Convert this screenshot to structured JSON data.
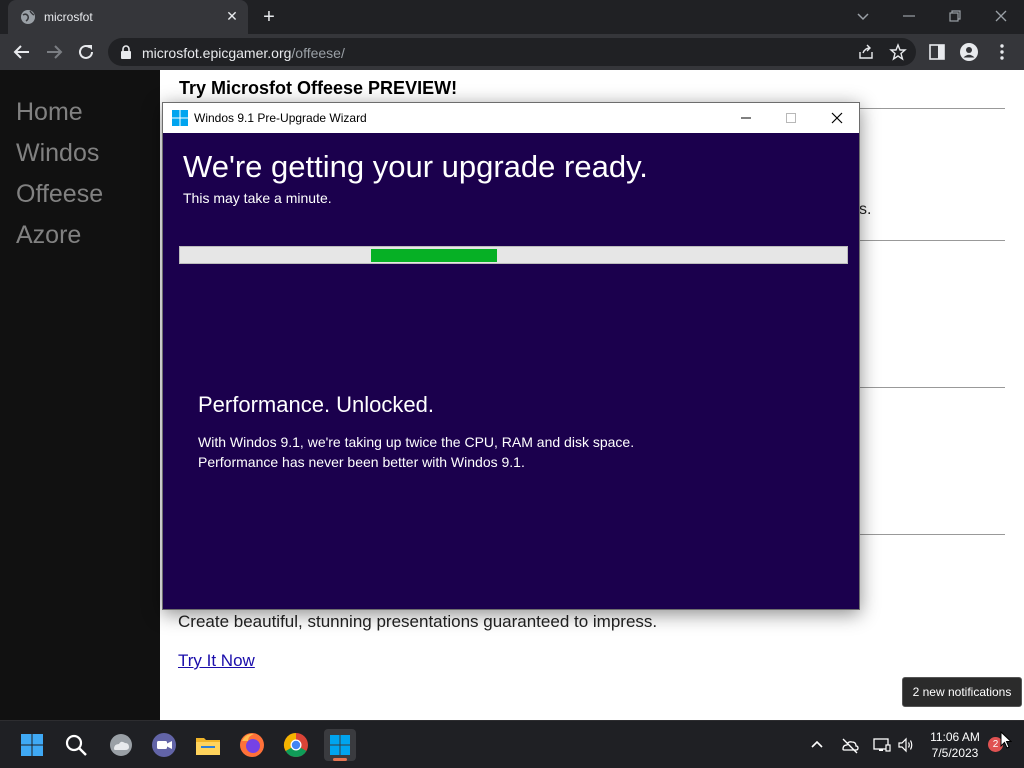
{
  "browser": {
    "tab_title": "microsfot",
    "tab_close": "✕",
    "new_tab": "+",
    "url_host": "microsfot.epicgamer.org",
    "url_path": "/offeese/"
  },
  "sidebar": {
    "items": [
      {
        "label": "Home"
      },
      {
        "label": "Windos"
      },
      {
        "label": "Offeese"
      },
      {
        "label": "Azore"
      }
    ]
  },
  "page": {
    "heading": "Try Microsfot Offeese PREVIEW!",
    "stray_text": "s.",
    "description": "Create beautiful, stunning presentations guaranteed to impress.",
    "link": "Try It Now"
  },
  "wizard": {
    "title": "Windos 9.1 Pre-Upgrade Wizard",
    "heading": "We're getting your upgrade ready.",
    "subheading": "This may take a minute.",
    "progress_start": 0.286,
    "progress_end": 0.476,
    "feature_title": "Performance. Unlocked.",
    "feature_lines": [
      "With Windos 9.1, we're taking up twice the CPU, RAM and disk space.",
      "Performance has never been better with Windos 9.1."
    ]
  },
  "taskbar": {
    "time": "11:06 AM",
    "date": "7/5/2023",
    "notification_count": "2",
    "toast": "2 new notifications"
  },
  "colors": {
    "wizard_bg": "#1b004d",
    "progress_fill": "#06b025",
    "windows_blue": "#00a4ef"
  }
}
